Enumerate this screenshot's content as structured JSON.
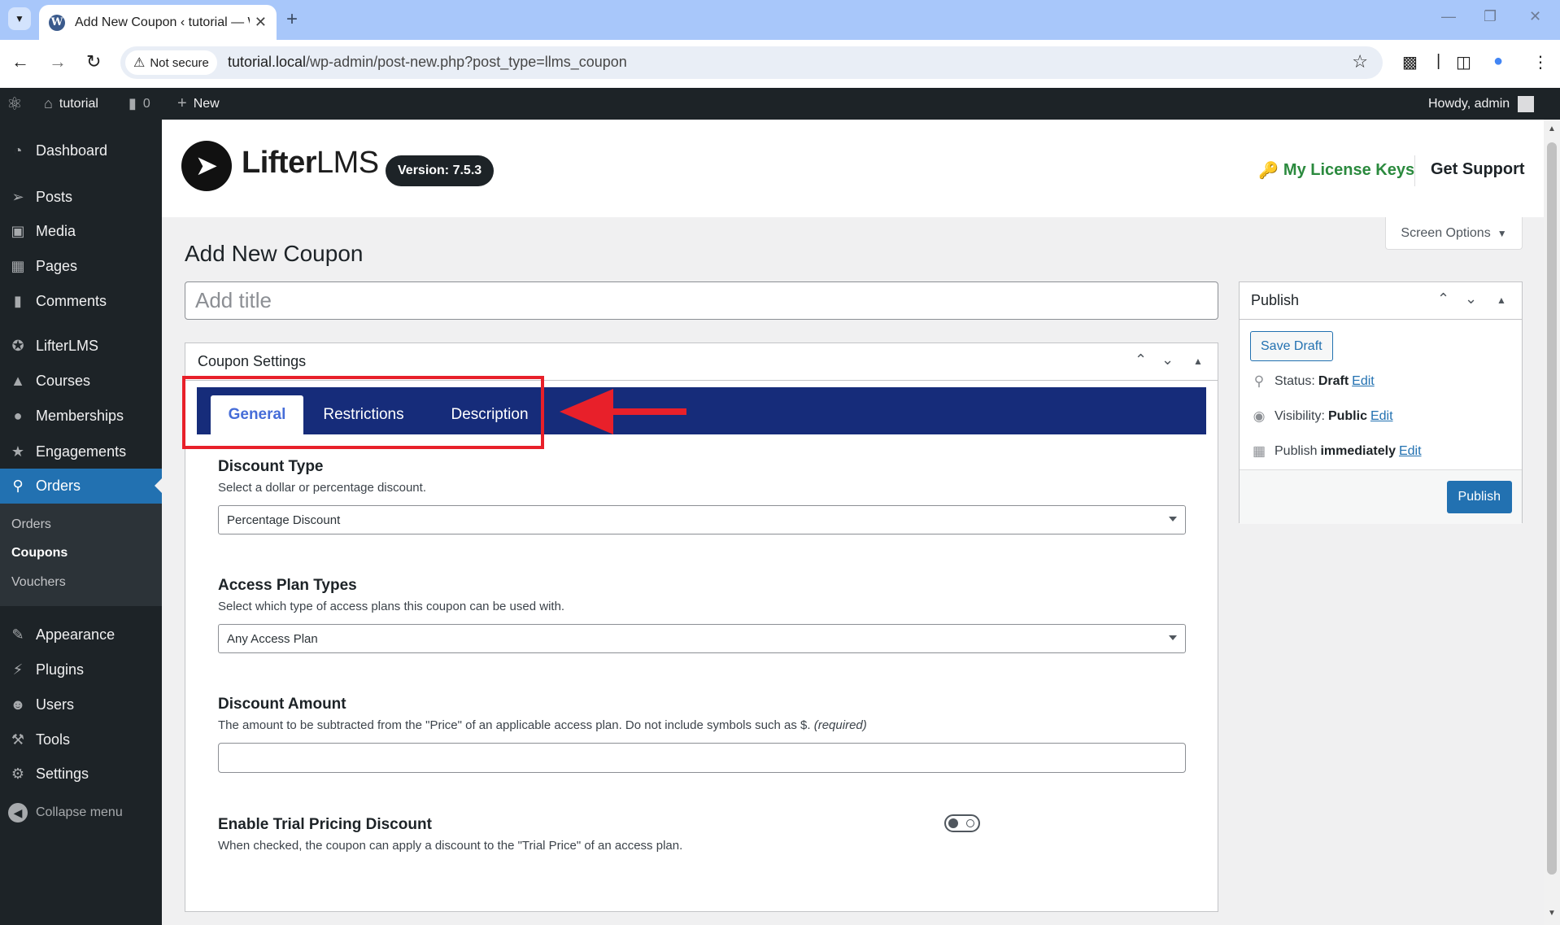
{
  "browser": {
    "tab_title": "Add New Coupon ‹ tutorial — WordPress",
    "new_tab_label": "+",
    "security_label": "Not secure",
    "url_host": "tutorial.local",
    "url_path": "/wp-admin/post-new.php?post_type=llms_coupon"
  },
  "adminbar": {
    "site_name": "tutorial",
    "comments_count": "0",
    "new_label": "New",
    "howdy": "Howdy, admin"
  },
  "sidebar": {
    "items": [
      {
        "label": "Dashboard",
        "icon": "dashboard-icon"
      },
      {
        "label": "Posts",
        "icon": "pin-icon"
      },
      {
        "label": "Media",
        "icon": "media-icon"
      },
      {
        "label": "Pages",
        "icon": "page-icon"
      },
      {
        "label": "Comments",
        "icon": "comment-icon"
      },
      {
        "label": "LifterLMS",
        "icon": "lifterlms-icon"
      },
      {
        "label": "Courses",
        "icon": "courses-icon"
      },
      {
        "label": "Memberships",
        "icon": "memberships-icon"
      },
      {
        "label": "Engagements",
        "icon": "engagements-icon"
      },
      {
        "label": "Orders",
        "icon": "cart-icon"
      },
      {
        "label": "Appearance",
        "icon": "brush-icon"
      },
      {
        "label": "Plugins",
        "icon": "plugin-icon"
      },
      {
        "label": "Users",
        "icon": "users-icon"
      },
      {
        "label": "Tools",
        "icon": "wrench-icon"
      },
      {
        "label": "Settings",
        "icon": "settings-icon"
      }
    ],
    "submenu": [
      "Orders",
      "Coupons",
      "Vouchers"
    ],
    "collapse_label": "Collapse menu"
  },
  "llms_header": {
    "brand_bold": "Lifter",
    "brand_light": "LMS",
    "version": "Version: 7.5.3",
    "license_link": "My License Keys",
    "support_link": "Get Support"
  },
  "page": {
    "screen_options": "Screen Options",
    "title": "Add New Coupon",
    "title_placeholder": "Add title"
  },
  "coupon_settings": {
    "box_title": "Coupon Settings",
    "tabs": [
      "General",
      "Restrictions",
      "Description"
    ],
    "active_tab": "General",
    "fields": {
      "discount_type": {
        "label": "Discount Type",
        "description": "Select a dollar or percentage discount.",
        "value": "Percentage Discount"
      },
      "access_plan_types": {
        "label": "Access Plan Types",
        "description": "Select which type of access plans this coupon can be used with.",
        "value": "Any Access Plan"
      },
      "discount_amount": {
        "label": "Discount Amount",
        "description": "The amount to be subtracted from the \"Price\" of an applicable access plan. Do not include symbols such as $.",
        "required": "(required)",
        "value": ""
      },
      "trial_discount": {
        "label": "Enable Trial Pricing Discount",
        "description": "When checked, the coupon can apply a discount to the \"Trial Price\" of an access plan.",
        "enabled": false
      }
    }
  },
  "publish": {
    "title": "Publish",
    "save_draft": "Save Draft",
    "status_label": "Status:",
    "status_value": "Draft",
    "visibility_label": "Visibility:",
    "visibility_value": "Public",
    "schedule_label": "Publish",
    "schedule_value": "immediately",
    "edit_label": "Edit",
    "publish_button": "Publish"
  },
  "colors": {
    "wp_dark": "#1d2327",
    "wp_blue": "#2271b1",
    "llms_tab_bar": "#162c7a",
    "llms_tab_active_text": "#466dd8",
    "annotation_red": "#e8202a",
    "license_green": "#2b8a3e"
  }
}
